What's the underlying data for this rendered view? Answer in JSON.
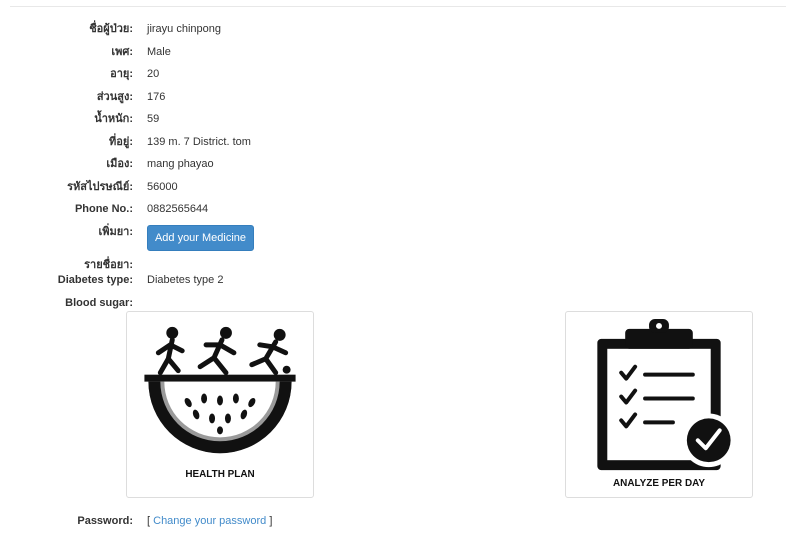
{
  "patient": {
    "name_label": "ชื่อผู้ป่วย:",
    "name_value": "jirayu chinpong",
    "gender_label": "เพศ:",
    "gender_value": "Male",
    "age_label": "อายุ:",
    "age_value": "20",
    "height_label": "ส่วนสูง:",
    "height_value": "176",
    "weight_label": "น้ำหนัก:",
    "weight_value": "59",
    "address_label": "ที่อยู่:",
    "address_value": "139 m. 7 District. tom",
    "city_label": "เมือง:",
    "city_value": "mang phayao",
    "postal_label": "รหัสไปรษณีย์:",
    "postal_value": "56000",
    "phone_label": "Phone No.:",
    "phone_value": "0882565644",
    "add_medicine_label": "เพิ่มยา:",
    "add_medicine_button": "Add your Medicine",
    "medicine_list_label": "รายชื่อยา:",
    "diabetes_label": "Diabetes type:",
    "diabetes_value": "Diabetes type 2",
    "blood_sugar_label": "Blood sugar:"
  },
  "cards": {
    "health_plan_caption": "HEALTH PLAN",
    "health_plan_icon": "health-plan-icon",
    "analyze_caption": "ANALYZE PER DAY",
    "analyze_icon": "clipboard-checklist-icon"
  },
  "password": {
    "label": "Password:",
    "bracket_open": "[",
    "link_text": "Change your password",
    "bracket_close": "]"
  },
  "colors": {
    "button_bg": "#428bca",
    "link": "#428bca",
    "icon_black": "#111111",
    "icon_gray": "#9a9a9a"
  }
}
